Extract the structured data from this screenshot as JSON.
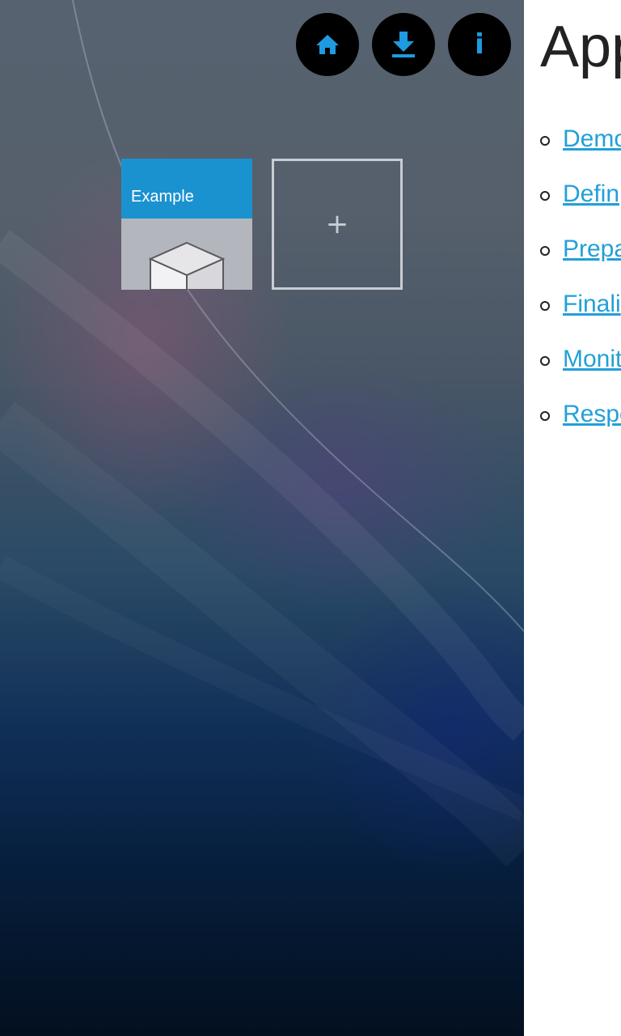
{
  "toolbar": {
    "home_icon": "home-icon",
    "download_icon": "download-icon",
    "info_icon": "info-icon",
    "info_glyph": "i",
    "accent_color": "#1e9be0"
  },
  "tiles": {
    "example_label": "Example",
    "example_header_color": "#1b92d0",
    "add_glyph": "+"
  },
  "panel": {
    "title": "App",
    "links": [
      "Demo",
      "Defin",
      "Prepa",
      "Finali",
      "Monit",
      "Respo"
    ],
    "link_color": "#22a0d8"
  }
}
